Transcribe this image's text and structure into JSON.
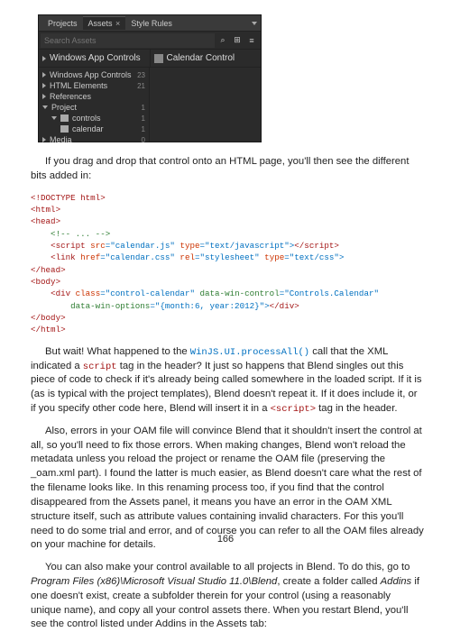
{
  "panel": {
    "tabs": [
      "Projects",
      "Assets",
      "Style Rules"
    ],
    "active_tab": 1,
    "search_placeholder": "Search Assets",
    "search_icon": "⌕",
    "view_grid_icon": "⊞",
    "view_list_icon": "≡",
    "left_sel": "Windows App Controls",
    "right_sel": "Calendar Control",
    "tree": [
      {
        "label": "Windows App Controls",
        "count": "23",
        "expandable": true
      },
      {
        "label": "HTML Elements",
        "count": "21",
        "expandable": true
      },
      {
        "label": "References",
        "count": "",
        "expandable": true
      },
      {
        "label": "Project",
        "count": "1",
        "expanded": true
      },
      {
        "label": "controls",
        "count": "1",
        "indent": 1,
        "expanded": true
      },
      {
        "label": "calendar",
        "count": "1",
        "indent": 2
      },
      {
        "label": "Media",
        "count": "0",
        "expandable": true
      }
    ]
  },
  "paragraphs": {
    "p1": "If you drag and drop that control onto an HTML page, you'll then see the different bits added in:",
    "p2a": "But wait! What happened to the ",
    "p2b": " call that the XML indicated a ",
    "p2c": " tag in the header? It just so happens that Blend singles out this piece of code to check if it's already being called somewhere in the loaded script. If it is (as is typical with the project templates), Blend doesn't repeat it. If it does include it, or if you specify other code here, Blend will insert it in a ",
    "p2d": " tag in the header.",
    "p2_code1": "WinJS.UI.processAll()",
    "p2_code2": "script",
    "p2_code3": "<script>",
    "p3": "Also, errors in your OAM file will convince Blend that it shouldn't insert the control at all, so you'll need to fix those errors. When making changes, Blend won't reload the metadata unless you reload the project or rename the OAM file (preserving the _oam.xml part). I found the latter is much easier, as Blend doesn't care what the rest of the filename looks like. In this renaming process too, if you find that the control disappeared from the Assets panel, it means you have an error in the OAM XML structure itself, such as attribute values containing invalid characters. For this you'll need to do some trial and error, and of course you can refer to all the OAM files already on your machine for details.",
    "p4a": "You can also make your control available to all projects in Blend. To do this, go to ",
    "p4b": ", create a folder called ",
    "p4c": " if one doesn't exist, create a subfolder therein for your control (using a reasonably unique name), and copy all your control assets there. When you restart Blend, you'll see the control listed under Addins in the Assets tab:",
    "p4_path": "Program Files (x86)\\Microsoft Visual Studio 11.0\\Blend",
    "p4_addins": "Addins"
  },
  "code": {
    "l1a": "<!DOCTYPE",
    "l1b": " html>",
    "l2a": "<html>",
    "l3a": "<head>",
    "l4a": "    <!-- ... -->",
    "l5pre": "    ",
    "l5a": "<script",
    "l5b": " src",
    "l5c": "=\"calendar.js\"",
    "l5d": " type",
    "l5e": "=\"text/javascript\">",
    "l5f": "</script>",
    "l6pre": "    ",
    "l6a": "<link",
    "l6b": " href",
    "l6c": "=\"calendar.css\"",
    "l6d": " rel",
    "l6e": "=\"stylesheet\"",
    "l6f": " type",
    "l6g": "=\"text/css\">",
    "l7a": "</head>",
    "l8a": "<body>",
    "l9pre": "    ",
    "l9a": "<div",
    "l9b": " class",
    "l9c": "=\"control-calendar\"",
    "l9d": " data-win-control",
    "l9e": "=\"Controls.Calendar\"",
    "l10pre": "        ",
    "l10a": "data-win-options",
    "l10b": "=\"{month:6, year:2012}\">",
    "l10c": "</div>",
    "l11a": "</body>",
    "l12a": "</html>"
  },
  "page_number": "166"
}
